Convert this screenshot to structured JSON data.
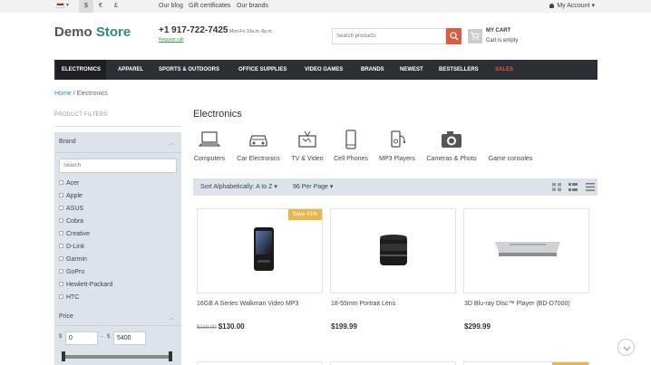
{
  "topbar": {
    "currencies": [
      "$",
      "€",
      "£"
    ],
    "links": [
      "Our blog",
      "Gift certificates",
      "Our brands"
    ],
    "account": "My Account"
  },
  "header": {
    "logo_demo": "Demo",
    "logo_store": "Store",
    "phone": "+1 917-722-7425",
    "hours": "Mon-Fri 10a.m.-6p.m.",
    "request_call": "Request call",
    "search_placeholder": "Search products",
    "cart_title": "MY CART",
    "cart_status": "Cart is empty"
  },
  "nav": [
    "ELECTRONICS",
    "APPAREL",
    "SPORTS & OUTDOORS",
    "OFFICE SUPPLIES",
    "VIDEO GAMES",
    "BRANDS",
    "NEWEST",
    "BESTSELLERS",
    "SALES"
  ],
  "breadcrumb": {
    "home": "Home",
    "separator": "/",
    "current": "Electronics"
  },
  "sidebar": {
    "title": "PRODUCT FILTERS",
    "brand_heading": "Brand",
    "brand_search_placeholder": "Search",
    "brands": [
      "Acer",
      "Apple",
      "ASUS",
      "Cobra",
      "Creative",
      "D-Link",
      "Garmin",
      "GoPro",
      "Hewlett-Packard",
      "HTC"
    ],
    "price_heading": "Price",
    "currency_symbol": "$",
    "price_dash": "-",
    "price_min": "0",
    "price_max": "5400"
  },
  "main": {
    "title": "Electronics",
    "subcategories": [
      "Computers",
      "Car Electronics",
      "TV & Video",
      "Cell Phones",
      "MP3 Players",
      "Cameras & Photo",
      "Game consoles"
    ],
    "sort_label": "Sort Alphabetically: A to Z",
    "per_page_label": "96 Per Page",
    "products": [
      {
        "name": "16GB A Series Walkman Video MP3",
        "old_price": "$219.00",
        "price": "$130.00",
        "badge": "Save 41%"
      },
      {
        "name": "18-55mm Portrait Lens",
        "old_price": "",
        "price": "$199.99",
        "badge": ""
      },
      {
        "name": "3D Blu-ray Disc™ Player (BD-D7000)",
        "old_price": "",
        "price": "$299.99",
        "badge": ""
      }
    ]
  },
  "colors": {
    "accent": "#2e8b7a",
    "search_button": "#e05a40",
    "nav_bg": "#2c2f36",
    "sales": "#e5573d",
    "badge": "#e8b64a",
    "filter_bg": "#dde3ea"
  }
}
